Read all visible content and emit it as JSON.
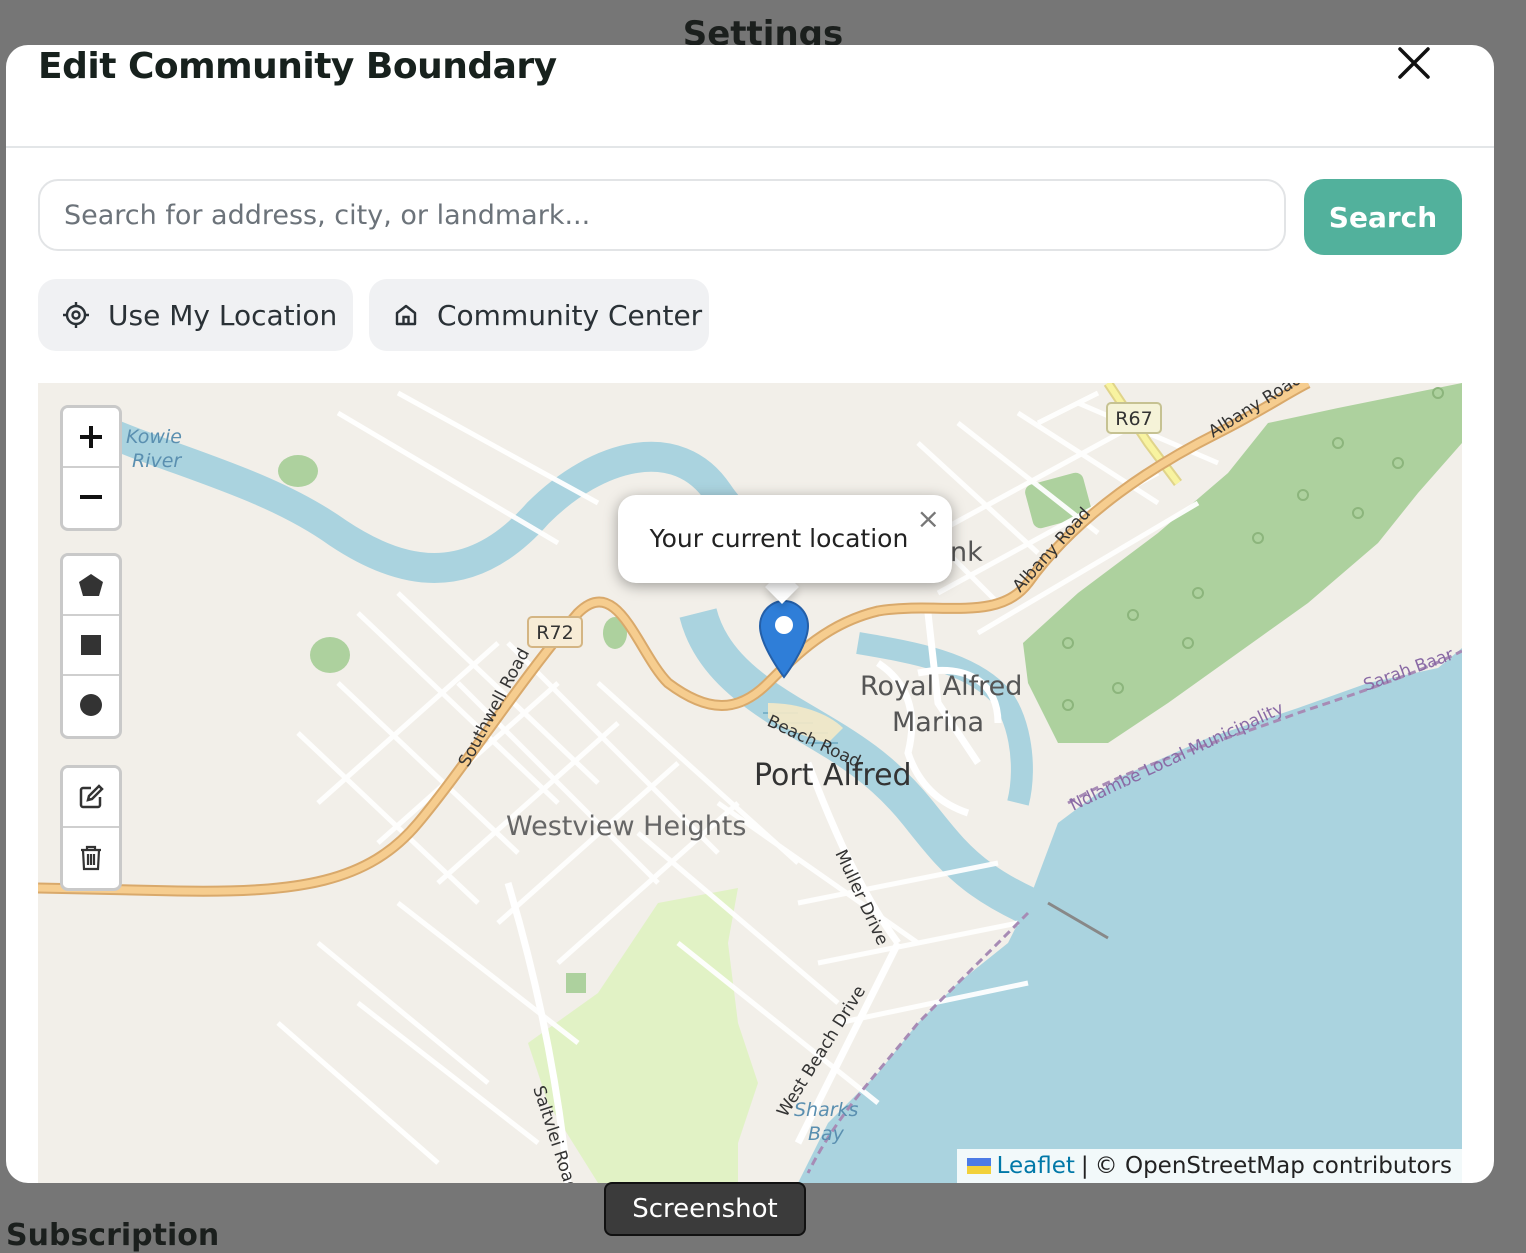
{
  "background": {
    "title": "Settings",
    "section": "Subscription"
  },
  "modal": {
    "title": "Edit Community Boundary",
    "close_icon": "close-icon"
  },
  "search": {
    "placeholder": "Search for address, city, or landmark...",
    "value": "",
    "button_label": "Search",
    "button_color": "#52b19c"
  },
  "quick_actions": [
    {
      "label": "Use My Location",
      "icon": "crosshair-icon"
    },
    {
      "label": "Community Center",
      "icon": "home-icon"
    }
  ],
  "map": {
    "zoom_controls": {
      "zoom_in": "+",
      "zoom_out": "−"
    },
    "draw_tools": [
      "polygon-icon",
      "rectangle-icon",
      "circle-icon"
    ],
    "edit_tools": [
      "edit-icon",
      "trash-icon"
    ],
    "popup_text": "Your current location",
    "labels": {
      "kowie_river": [
        "Kowie",
        "River"
      ],
      "r67": "R67",
      "r72": "R72",
      "albany_road_top": "Albany Road",
      "albany_road": "Albany Road",
      "southwell_road": "Southwell Road",
      "royal_alfred": "Royal Alfred",
      "marina": "Marina",
      "beach_road": "Beach Road",
      "port_alfred": "Port Alfred",
      "westview_heights": "Westview Heights",
      "muller_drive": "Muller Drive",
      "ndlambe": "Ndlambe Local Municipality",
      "sarah_baartman": "Sarah Baar",
      "west_beach_drive": "West Beach Drive",
      "sharks_bay": [
        "Sharks",
        "Bay"
      ],
      "saltvlei_road": "Saltvlei Road",
      "partial_k": "nk"
    },
    "attribution": {
      "leaflet": "Leaflet",
      "separator": "|",
      "osm": "© OpenStreetMap contributors"
    },
    "colors": {
      "land": "#f2efe9",
      "water": "#aad3df",
      "forest": "#add19e",
      "park": "#e1f2c5",
      "major_road": "#f6cd8f",
      "marker": "#2f7ed8"
    }
  },
  "tooltip": "Screenshot"
}
